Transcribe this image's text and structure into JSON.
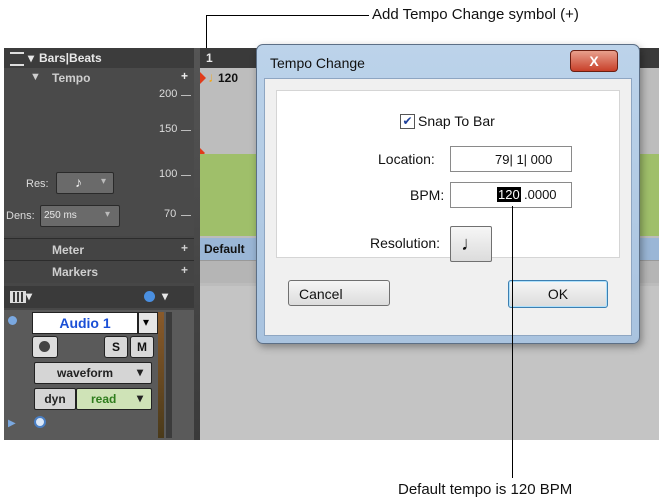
{
  "callouts": {
    "top": "Add Tempo Change symbol (+)",
    "bottom": "Default tempo is 120 BPM"
  },
  "ruler": {
    "label": "Bars|Beats",
    "bar_number": "1",
    "tempo_marker": "120"
  },
  "tempo": {
    "label": "Tempo",
    "add_symbol": "+",
    "ticks": [
      "200",
      "150",
      "100",
      "70"
    ],
    "res_label": "Res:",
    "dens_label": "Dens:",
    "dens_value": "250 ms"
  },
  "meter": {
    "label": "Meter",
    "add_symbol": "+",
    "value": "Default"
  },
  "markers": {
    "label": "Markers",
    "add_symbol": "+"
  },
  "track": {
    "name": "Audio 1",
    "solo": "S",
    "mute": "M",
    "view": "waveform",
    "automation_type": "dyn",
    "automation_mode": "read"
  },
  "dialog": {
    "title": "Tempo Change",
    "close_symbol": "X",
    "snap_label": "Snap To Bar",
    "snap_checked": true,
    "location_label": "Location:",
    "location_value": "79| 1| 000",
    "bpm_label": "BPM:",
    "bpm_selected": "120",
    "bpm_rest": ".0000",
    "resolution_label": "Resolution:",
    "cancel_label": "Cancel",
    "ok_label": "OK"
  },
  "colors": {
    "green_zone": "#9fbf6a",
    "track_name_text": "#1a4fd6",
    "dialog_frame": "#bcd3ea"
  }
}
